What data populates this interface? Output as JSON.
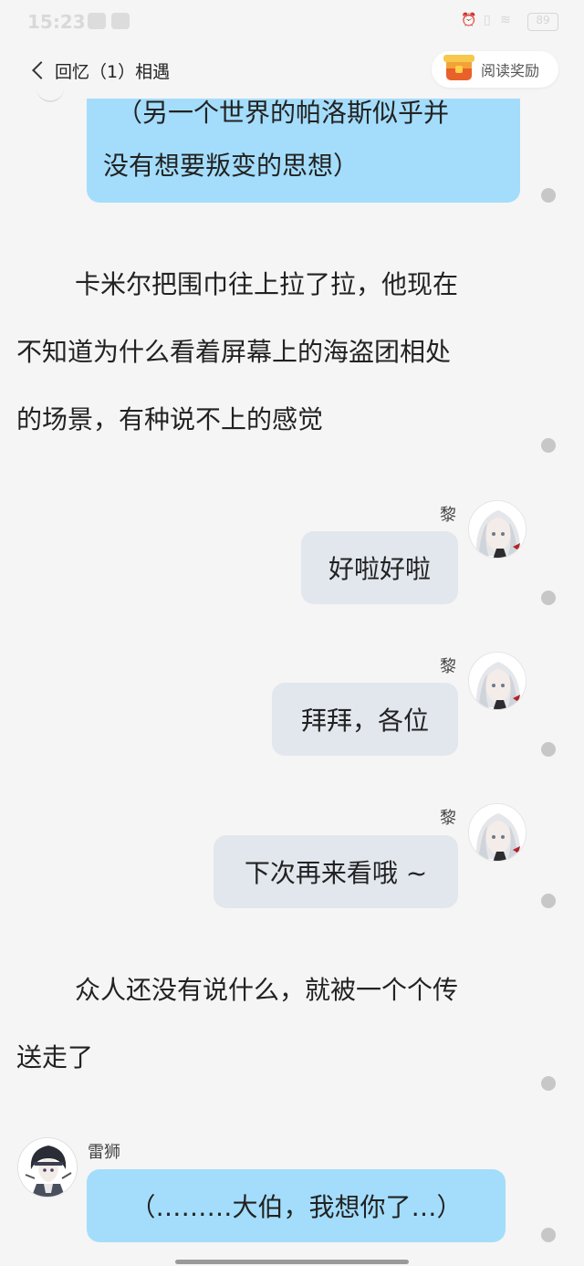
{
  "status_bar": {
    "time": "15:23",
    "battery": "89"
  },
  "header": {
    "back_label": "回忆（1）相遇",
    "reward_label": "阅读奖励"
  },
  "messages": {
    "m1": {
      "lines": [
        "（另一个世界的帕洛斯似乎并",
        "没有想要叛变的思想）"
      ]
    },
    "n1": {
      "lines": [
        "卡米尔把围巾往上拉了拉，他现在",
        "不知道为什么看着屏幕上的海盗团相处",
        "的场景，有种说不上的感觉"
      ]
    },
    "m2": {
      "sender": "黎",
      "text": "好啦好啦"
    },
    "m3": {
      "sender": "黎",
      "text": "拜拜，各位"
    },
    "m4": {
      "sender": "黎",
      "text": "下次再来看哦 ~"
    },
    "n2": {
      "lines": [
        "众人还没有说什么，就被一个个传",
        "送走了"
      ]
    },
    "m5": {
      "sender": "雷狮",
      "text": "（………大伯，我想你了…）"
    }
  },
  "colors": {
    "background": "#f5f5f5",
    "bubble_blue": "#a4ddfb",
    "bubble_gray": "#e2e7ee",
    "dot": "#c7c7c7"
  },
  "icons": [
    "back-chevron-icon",
    "treasure-chest-icon",
    "comment-dot-icon"
  ]
}
